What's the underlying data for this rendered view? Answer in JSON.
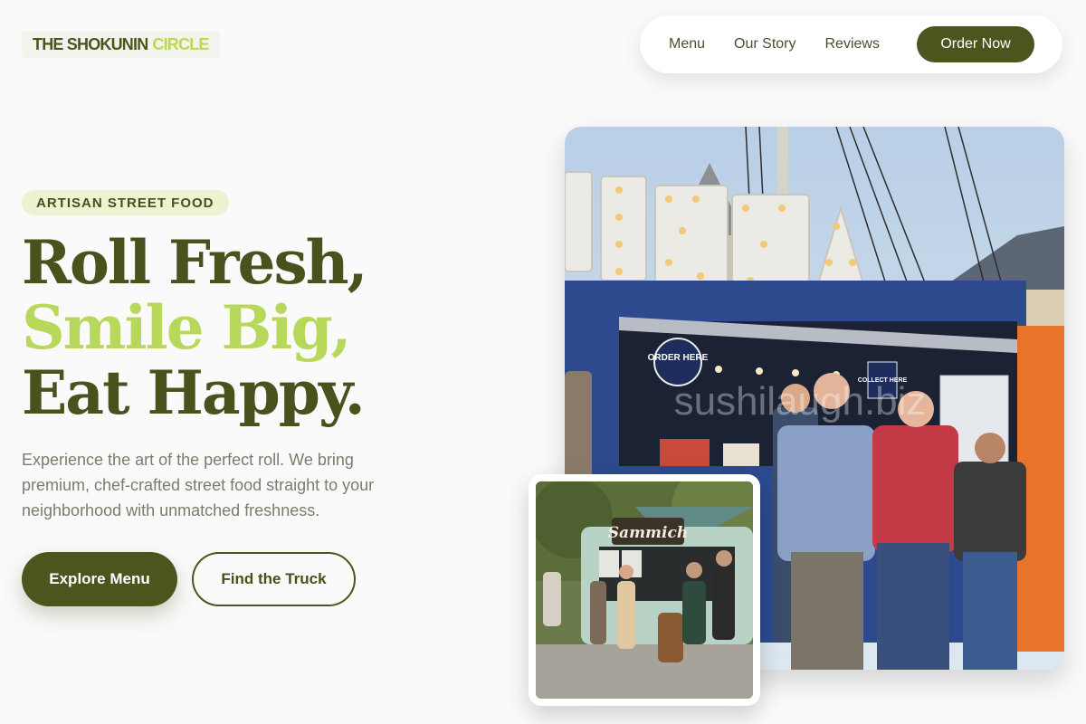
{
  "brand": {
    "name_part1": "THE SHOKUNIN",
    "name_part2": "CIRCLE"
  },
  "nav": {
    "items": [
      {
        "label": "Menu"
      },
      {
        "label": "Our Story"
      },
      {
        "label": "Reviews"
      }
    ],
    "cta": "Order Now"
  },
  "hero": {
    "badge": "ARTISAN STREET FOOD",
    "headline": {
      "line1": "Roll Fresh,",
      "line2": "Smile Big,",
      "line3": "Eat Happy."
    },
    "description": "Experience the art of the perfect roll. We bring premium, chef-crafted street food straight to your neighborhood with unmatched freshness.",
    "primary_button": "Explore Menu",
    "secondary_button": "Find the Truck"
  },
  "photos": {
    "main": {
      "sign_letters": "PIZZA",
      "order_sign": "ORDER HERE",
      "collect_sign": "COLLECT HERE",
      "watermark": "sushilaugh.biz"
    },
    "small": {
      "sign": "Sammich"
    }
  },
  "colors": {
    "primary": "#4b561f",
    "accent": "#b9d957",
    "badge_bg": "#ebf3d2",
    "text_muted": "#7a7d6d"
  }
}
